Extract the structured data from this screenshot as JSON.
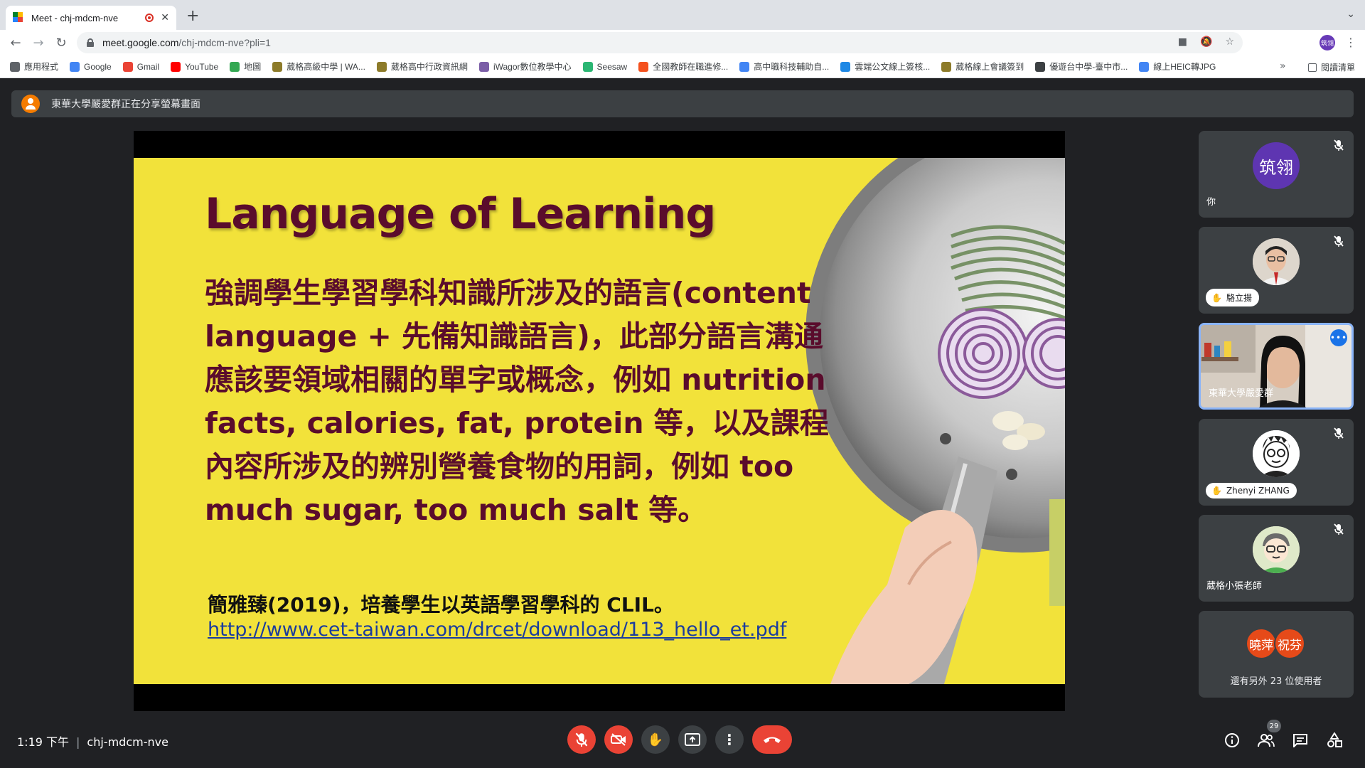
{
  "browser": {
    "tab_title": "Meet - chj-mdcm-nve",
    "url_host": "meet.google.com",
    "url_path": "/chj-mdcm-nve?pli=1",
    "profile_initials": "筑翎"
  },
  "bookmarks": [
    {
      "label": "應用程式",
      "icon": "apps-grid-icon",
      "color": "#5f6368"
    },
    {
      "label": "Google",
      "icon": "google-icon",
      "color": "#4285f4"
    },
    {
      "label": "Gmail",
      "icon": "gmail-icon",
      "color": "#ea4335"
    },
    {
      "label": "YouTube",
      "icon": "youtube-icon",
      "color": "#ff0000"
    },
    {
      "label": "地圖",
      "icon": "maps-pin-icon",
      "color": "#34a853"
    },
    {
      "label": "葳格高級中學 | WA...",
      "icon": "school-crest-icon",
      "color": "#8d7b2a"
    },
    {
      "label": "葳格高中行政資訊網",
      "icon": "school-crest-icon",
      "color": "#8d7b2a"
    },
    {
      "label": "iWagor數位教學中心",
      "icon": "iwagor-icon",
      "color": "#7b5ea7"
    },
    {
      "label": "Seesaw",
      "icon": "seesaw-icon",
      "color": "#2bb673"
    },
    {
      "label": "全國教師在職進修...",
      "icon": "teacher-icon",
      "color": "#f4511e"
    },
    {
      "label": "高中職科技輔助自...",
      "icon": "doc-icon",
      "color": "#4285f4"
    },
    {
      "label": "雲端公文線上簽核...",
      "icon": "cloud-doc-icon",
      "color": "#1e88e5"
    },
    {
      "label": "葳格線上會議簽到",
      "icon": "school-crest-icon",
      "color": "#8d7b2a"
    },
    {
      "label": "優遊台中學-臺中市...",
      "icon": "globe-icon",
      "color": "#3c4043"
    },
    {
      "label": "線上HEIC轉JPG",
      "icon": "image-convert-icon",
      "color": "#4285f4"
    }
  ],
  "reading_list": "閱讀清單",
  "banner": {
    "text": "東華大學嚴愛群正在分享螢幕畫面"
  },
  "slide": {
    "title": "Language of Learning",
    "body": "強調學生學習學科知識所涉及的語言(content language + 先備知識語言)，此部分語言溝通應該要領域相關的單字或概念，例如 nutrition facts, calories, fat, protein 等，以及課程內容所涉及的辨別營養食物的用詞，例如 too much sugar, too much salt 等。",
    "citation": "簡雅臻(2019)，培養學生以英語學習學科的 CLIL。",
    "link": "http://www.cet-taiwan.com/drcet/download/113_hello_et.pdf"
  },
  "participants": [
    {
      "name": "你",
      "avatar_text": "筑翎",
      "avatar_color": "#5e35b1",
      "mic_muted": true
    },
    {
      "name": "駱立揚",
      "hand_raised": true,
      "mic_muted": true
    },
    {
      "name": "東華大學嚴愛群",
      "speaking": true
    },
    {
      "name": "Zhenyi ZHANG",
      "hand_raised": true,
      "mic_muted": true
    },
    {
      "name": "葳格小張老師",
      "mic_muted": true
    }
  ],
  "others": {
    "avatars": [
      "曉萍",
      "祝芬"
    ],
    "text": "還有另外 23 位使用者"
  },
  "footer": {
    "time": "1:19 下午",
    "meeting_code": "chj-mdcm-nve",
    "people_count": "29"
  }
}
